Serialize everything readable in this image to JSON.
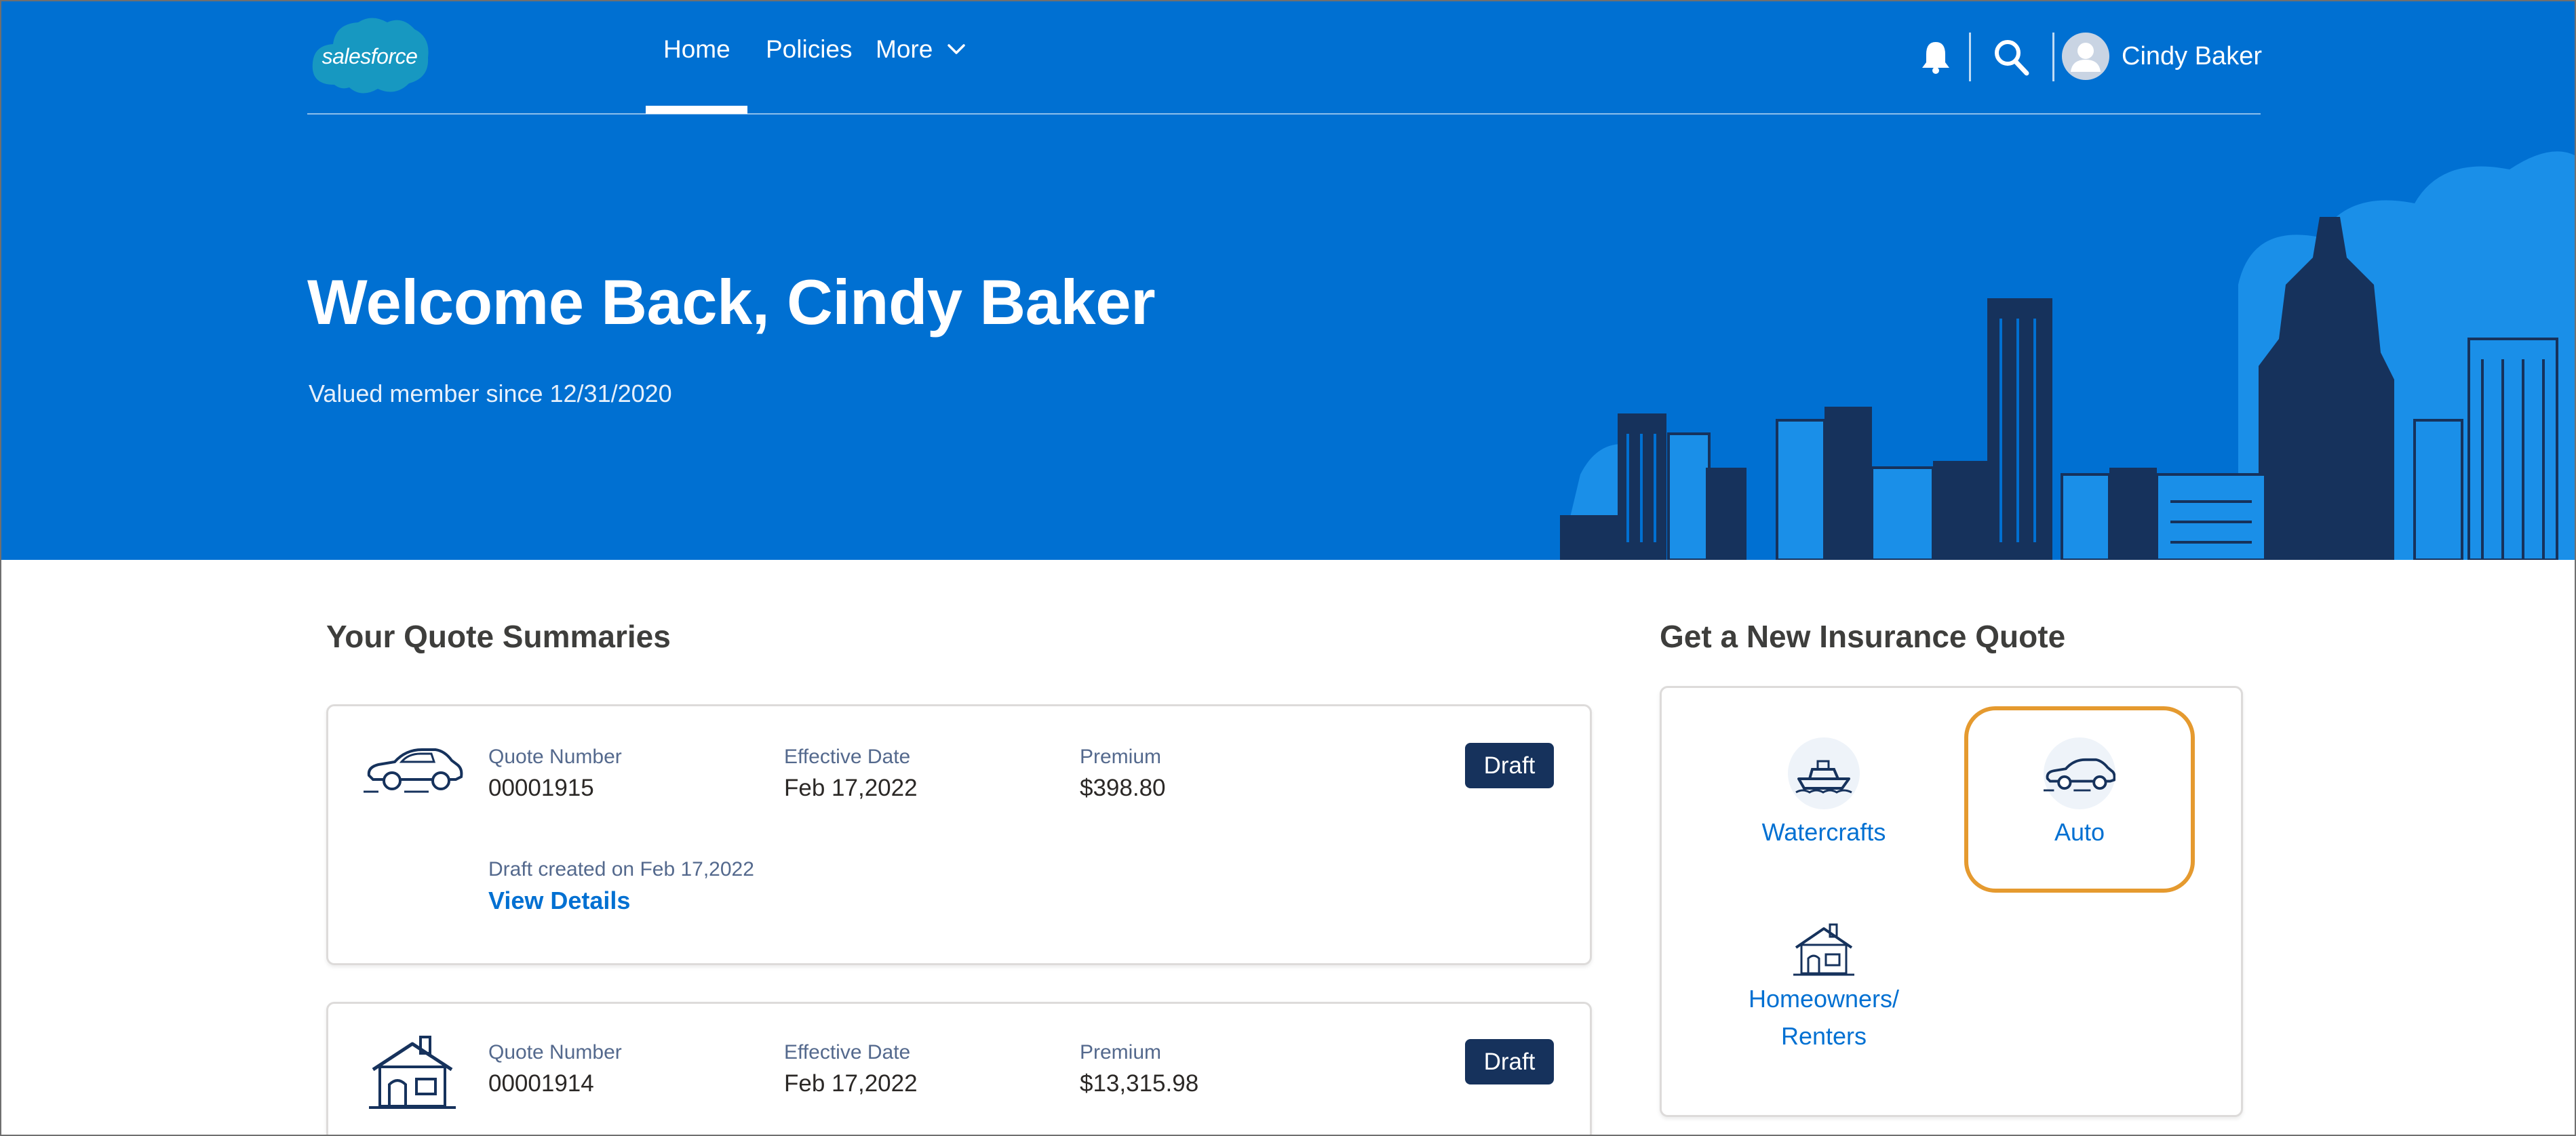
{
  "brand": {
    "logo_text": "salesforce"
  },
  "nav": {
    "tabs": [
      {
        "label": "Home",
        "active": true
      },
      {
        "label": "Policies"
      },
      {
        "label": "More"
      }
    ]
  },
  "header": {
    "user_name": "Cindy Baker",
    "icons": [
      "bell-icon",
      "search-icon",
      "avatar-icon"
    ]
  },
  "hero": {
    "welcome": "Welcome Back, Cindy Baker",
    "member_since": "Valued member since 12/31/2020"
  },
  "quote_summaries": {
    "title": "Your Quote Summaries",
    "labels": {
      "quote_number": "Quote Number",
      "effective_date": "Effective Date",
      "premium": "Premium"
    },
    "quotes": [
      {
        "icon": "car-icon",
        "quote_number": "00001915",
        "effective_date": "Feb 17,2022",
        "premium": "$398.80",
        "status": "Draft",
        "draft_created": "Draft created on Feb 17,2022",
        "view_details": "View Details"
      },
      {
        "icon": "house-icon",
        "quote_number": "00001914",
        "effective_date": "Feb 17,2022",
        "premium": "$13,315.98",
        "status": "Draft"
      }
    ]
  },
  "new_quote": {
    "title": "Get a New Insurance Quote",
    "options": [
      {
        "label": "Watercrafts",
        "icon": "boat-icon"
      },
      {
        "label": "Auto",
        "icon": "car-icon",
        "highlighted": true
      },
      {
        "label_line1": "Homeowners/",
        "label_line2": "Renters",
        "icon": "house-icon"
      }
    ]
  },
  "colors": {
    "hero_blue": "#0070d2",
    "skyline_dark": "#16325c",
    "skyline_light": "#1a8fe8",
    "draft_badge": "#16325c",
    "link": "#0070d2",
    "highlight": "#e59a2f"
  }
}
